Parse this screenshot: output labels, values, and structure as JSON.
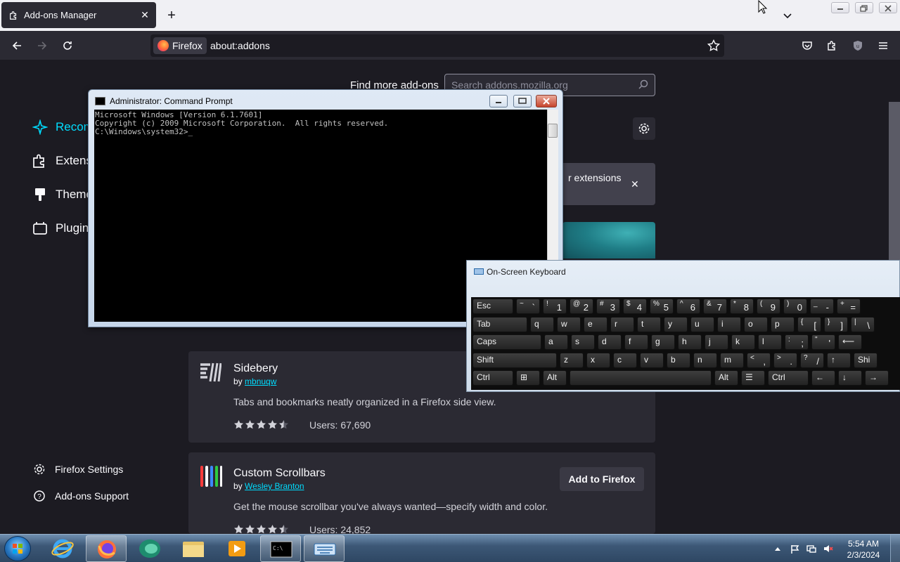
{
  "browser": {
    "tab": {
      "title": "Add-ons Manager"
    },
    "identity_label": "Firefox",
    "url": "about:addons"
  },
  "sidebar": {
    "items": [
      {
        "label": "Recommendations",
        "icon": "sparkle-icon",
        "active": true
      },
      {
        "label": "Extensions",
        "icon": "puzzle-icon"
      },
      {
        "label": "Themes",
        "icon": "brush-icon"
      },
      {
        "label": "Plugins",
        "icon": "plugin-icon"
      }
    ],
    "footer": [
      {
        "label": "Firefox Settings",
        "icon": "gear-icon"
      },
      {
        "label": "Add-ons Support",
        "icon": "help-icon"
      }
    ]
  },
  "main": {
    "find_label": "Find more add-ons",
    "search_placeholder": "Search addons.mozilla.org",
    "banner_text": "r extensions",
    "cards": [
      {
        "name": "Sidebery",
        "by": "by",
        "author": "mbnuqw",
        "description": "Tabs and bookmarks neatly organized in a Firefox side view.",
        "rating": 4.5,
        "users": "Users: 67,690"
      },
      {
        "name": "Custom Scrollbars",
        "by": "by",
        "author": "Wesley Branton",
        "description": "Get the mouse scrollbar you've always wanted—specify width and color.",
        "rating": 4.5,
        "users": "Users: 24,852",
        "button": "Add to Firefox"
      }
    ]
  },
  "cmd": {
    "title": "Administrator: Command Prompt",
    "lines": [
      "Microsoft Windows [Version 6.1.7601]",
      "Copyright (c) 2009 Microsoft Corporation.  All rights reserved.",
      "",
      "C:\\Windows\\system32>_"
    ]
  },
  "osk": {
    "title": "On-Screen Keyboard",
    "rows": [
      [
        {
          "t": "Esc"
        },
        {
          "s": "~",
          "m": "`"
        },
        {
          "s": "!",
          "m": "1"
        },
        {
          "s": "@",
          "m": "2"
        },
        {
          "s": "#",
          "m": "3"
        },
        {
          "s": "$",
          "m": "4"
        },
        {
          "s": "%",
          "m": "5"
        },
        {
          "s": "^",
          "m": "6"
        },
        {
          "s": "&",
          "m": "7"
        },
        {
          "s": "*",
          "m": "8"
        },
        {
          "s": "(",
          "m": "9"
        },
        {
          "s": ")",
          "m": "0"
        },
        {
          "s": "_",
          "m": "-"
        },
        {
          "s": "+",
          "m": "="
        }
      ],
      [
        {
          "t": "Tab"
        },
        {
          "t": "q"
        },
        {
          "t": "w"
        },
        {
          "t": "e"
        },
        {
          "t": "r"
        },
        {
          "t": "t"
        },
        {
          "t": "y"
        },
        {
          "t": "u"
        },
        {
          "t": "i"
        },
        {
          "t": "o"
        },
        {
          "t": "p"
        },
        {
          "s": "{",
          "m": "["
        },
        {
          "s": "}",
          "m": "]"
        },
        {
          "s": "|",
          "m": "\\"
        }
      ],
      [
        {
          "t": "Caps"
        },
        {
          "t": "a"
        },
        {
          "t": "s"
        },
        {
          "t": "d"
        },
        {
          "t": "f"
        },
        {
          "t": "g"
        },
        {
          "t": "h"
        },
        {
          "t": "j"
        },
        {
          "t": "k"
        },
        {
          "t": "l"
        },
        {
          "s": ":",
          "m": ";"
        },
        {
          "s": "\"",
          "m": "'"
        },
        {
          "t": "⟵"
        }
      ],
      [
        {
          "t": "Shift"
        },
        {
          "t": "z"
        },
        {
          "t": "x"
        },
        {
          "t": "c"
        },
        {
          "t": "v"
        },
        {
          "t": "b"
        },
        {
          "t": "n"
        },
        {
          "t": "m"
        },
        {
          "s": "<",
          "m": ","
        },
        {
          "s": ">",
          "m": "."
        },
        {
          "s": "?",
          "m": "/"
        },
        {
          "t": "↑"
        },
        {
          "t": "Shi"
        }
      ],
      [
        {
          "t": "Ctrl"
        },
        {
          "t": "⊞"
        },
        {
          "t": "Alt"
        },
        {
          "t": ""
        },
        {
          "t": "Alt"
        },
        {
          "t": "☰"
        },
        {
          "t": "Ctrl"
        },
        {
          "t": "←"
        },
        {
          "t": "↓"
        },
        {
          "t": "→"
        }
      ]
    ]
  },
  "taskbar": {
    "clock_time": "5:54 AM",
    "clock_date": "2/3/2024"
  }
}
